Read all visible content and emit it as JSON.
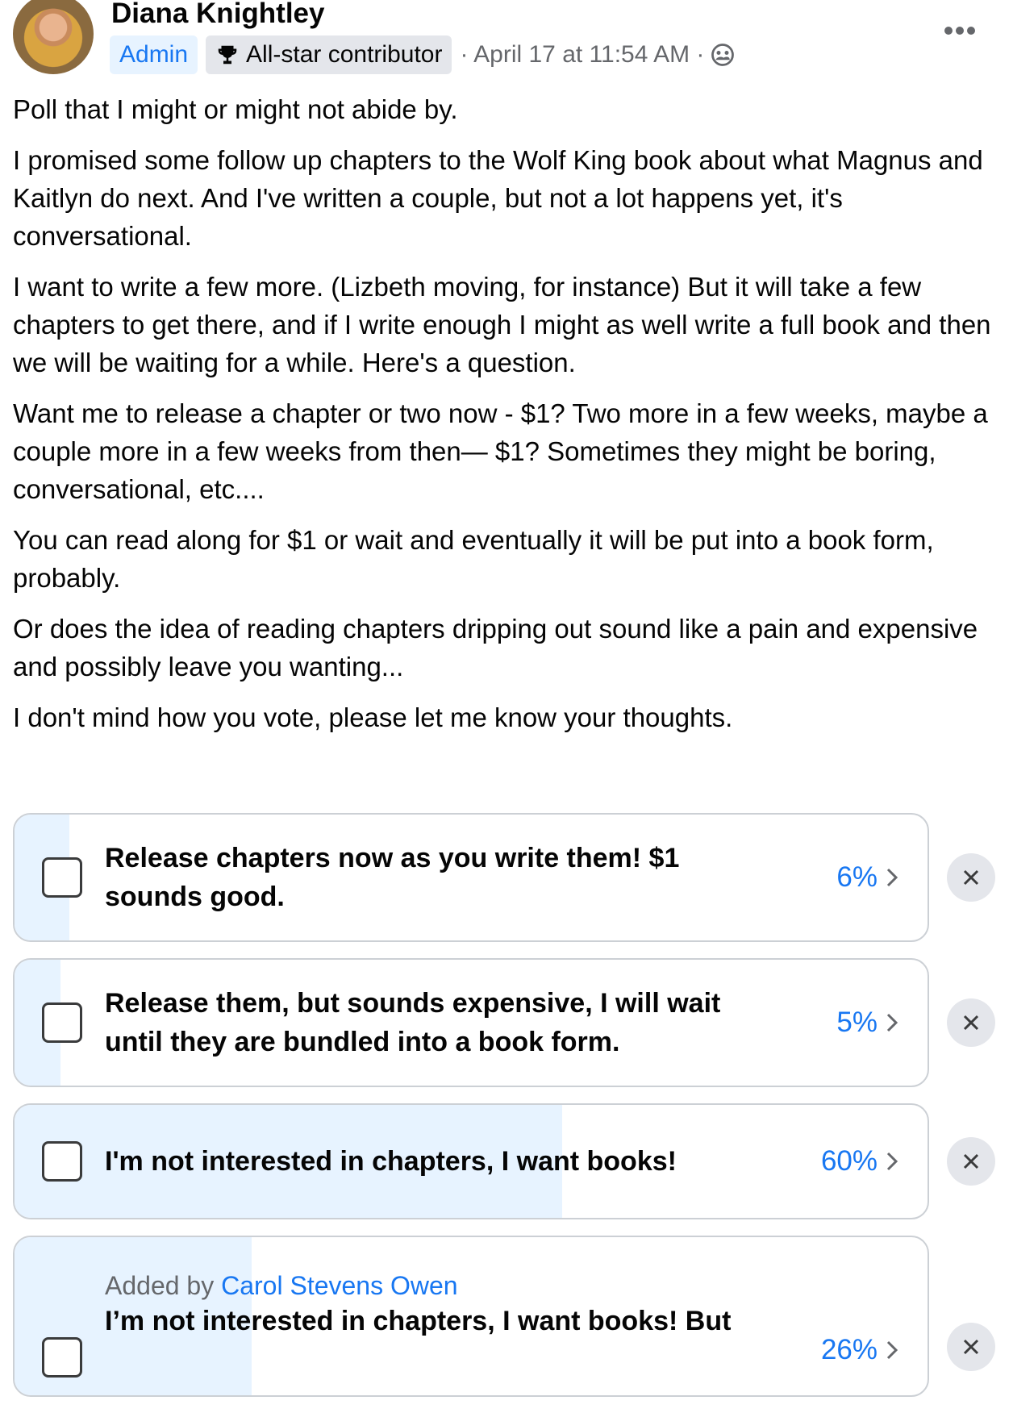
{
  "header": {
    "author": "Diana Knightley",
    "admin_badge": "Admin",
    "contributor_badge": "All-star contributor",
    "timestamp": "· April 17 at 11:54 AM ·",
    "privacy_icon": "group-icon",
    "more_icon": "more-options-icon"
  },
  "post": {
    "paragraphs": [
      "Poll that I might or might not abide by.",
      "I promised some follow up chapters to the Wolf King book about what Magnus and Kaitlyn do next. And I've written a couple, but not a lot happens yet, it's conversational.",
      "I want to write a few more. (Lizbeth moving, for instance) But it will take a few chapters to get there, and if I write enough I might as well write a full book and then we will be waiting for a while. Here's a question.",
      "Want me to release a chapter or two now - $1? Two more in a few weeks, maybe a couple more in a few weeks from then— $1? Sometimes they might be boring, conversational, etc....",
      "You can read along for $1 or wait and eventually it will be put into a book form, probably.",
      "Or does the idea of reading chapters dripping out sound like a pain and expensive and possibly leave you wanting...",
      "I don't mind how you vote, please let me know your thoughts."
    ]
  },
  "poll": {
    "options": [
      {
        "text": "Release chapters now as you write them! $1 sounds good.",
        "percent_label": "6%",
        "percent": 6
      },
      {
        "text": "Release them, but sounds expensive, I will wait until they are bundled into a book form.",
        "percent_label": "5%",
        "percent": 5
      },
      {
        "text": "I'm not interested in chapters, I want books!",
        "percent_label": "60%",
        "percent": 60
      },
      {
        "added_by_prefix": "Added by",
        "added_by_name": "Carol Stevens Owen",
        "text": "I’m not interested in chapters, I want books! But",
        "percent_label": "26%",
        "percent": 26
      }
    ]
  },
  "colors": {
    "accent": "#1877f2",
    "fill": "#e7f3ff",
    "muted": "#65676b"
  }
}
